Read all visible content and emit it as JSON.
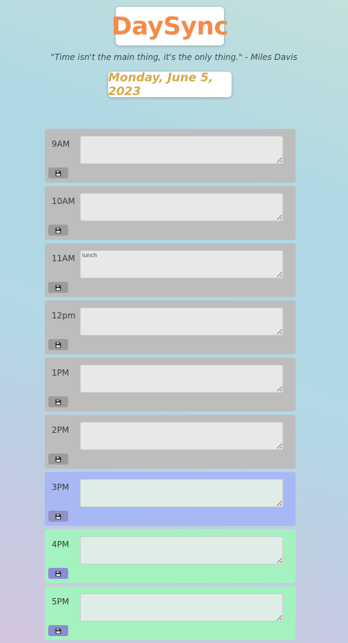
{
  "header": {
    "app_title": "DaySync",
    "quote": "\"Time isn't the main thing, it's the only thing.\" - Miles Davis",
    "current_date": "Monday, June 5, 2023"
  },
  "colors": {
    "brand": "#f48a4a",
    "date_accent": "#d6a94a",
    "past": "#bdbdbd",
    "present": "#a8b8f4",
    "future": "#a4f2bf"
  },
  "slots": [
    {
      "hour": "9AM",
      "state": "past",
      "text": "",
      "save_icon": "floppy-disk-icon"
    },
    {
      "hour": "10AM",
      "state": "past",
      "text": "",
      "save_icon": "floppy-disk-icon"
    },
    {
      "hour": "11AM",
      "state": "past",
      "text": "lunch",
      "save_icon": "floppy-disk-icon"
    },
    {
      "hour": "12pm",
      "state": "past",
      "text": "",
      "save_icon": "floppy-disk-icon"
    },
    {
      "hour": "1PM",
      "state": "past",
      "text": "",
      "save_icon": "floppy-disk-icon"
    },
    {
      "hour": "2PM",
      "state": "past",
      "text": "",
      "save_icon": "floppy-disk-icon"
    },
    {
      "hour": "3PM",
      "state": "present",
      "text": "",
      "save_icon": "floppy-disk-icon"
    },
    {
      "hour": "4PM",
      "state": "future",
      "text": "",
      "save_icon": "floppy-disk-icon"
    },
    {
      "hour": "5PM",
      "state": "future",
      "text": "",
      "save_icon": "floppy-disk-icon"
    }
  ]
}
